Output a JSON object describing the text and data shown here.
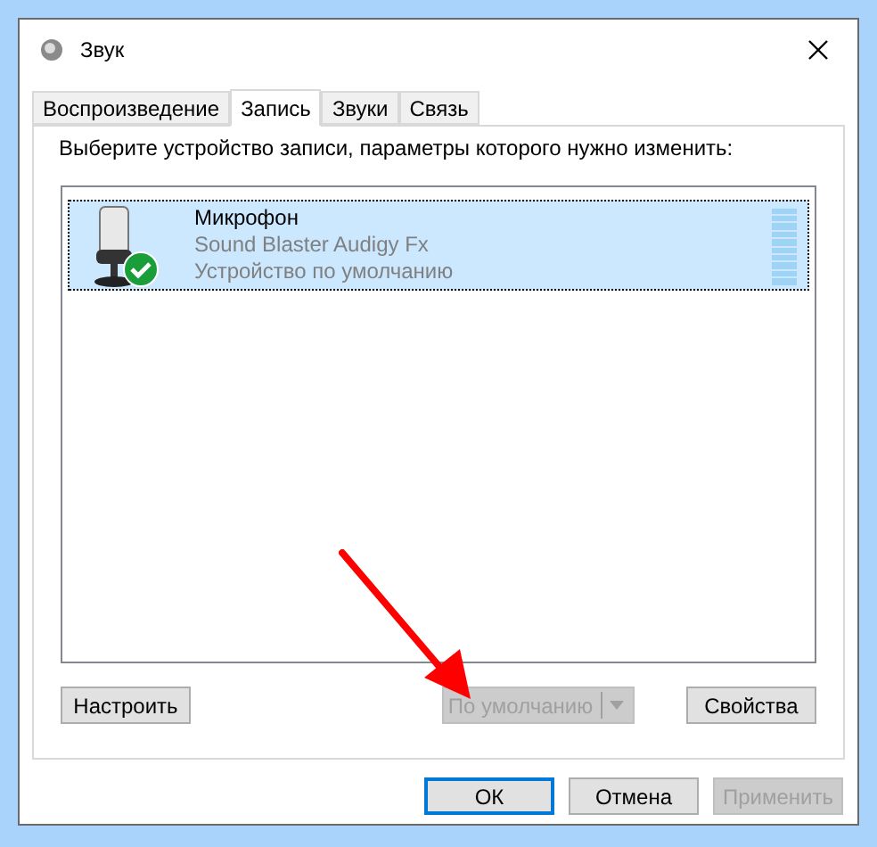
{
  "window": {
    "title": "Звук"
  },
  "tabs": [
    {
      "label": "Воспроизведение",
      "selected": false
    },
    {
      "label": "Запись",
      "selected": true
    },
    {
      "label": "Звуки",
      "selected": false
    },
    {
      "label": "Связь",
      "selected": false
    }
  ],
  "instruction": "Выберите устройство записи, параметры которого нужно изменить:",
  "devices": [
    {
      "name": "Микрофон",
      "hardware": "Sound Blaster Audigy Fx",
      "status": "Устройство по умолчанию",
      "selected": true,
      "default": true,
      "level": 0
    }
  ],
  "panel_buttons": [
    {
      "label": "Настроить",
      "disabled": false,
      "dropdown": false
    },
    {
      "label": "По умолчанию",
      "disabled": true,
      "dropdown": true
    },
    {
      "label": "Свойства",
      "disabled": false,
      "dropdown": false
    }
  ],
  "dialog_buttons": [
    {
      "label": "ОК",
      "disabled": false,
      "focused": true
    },
    {
      "label": "Отмена",
      "disabled": false,
      "focused": false
    },
    {
      "label": "Применить",
      "disabled": true,
      "focused": false
    }
  ]
}
